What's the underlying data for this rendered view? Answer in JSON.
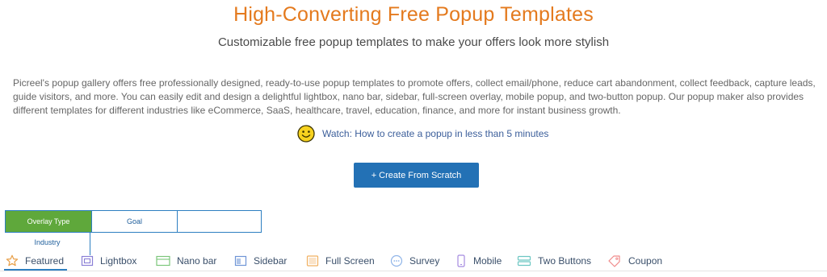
{
  "header": {
    "title": "High-Converting Free Popup Templates",
    "subtitle": "Customizable free popup templates to make your offers look more stylish"
  },
  "description": "Picreel's popup gallery offers free professionally designed, ready-to-use popup templates to promote offers, collect email/phone, reduce cart abandonment, collect feedback, capture leads, guide visitors, and more. You can easily edit and design a delightful lightbox, nano bar, sidebar, full-screen overlay, mobile popup, and two-button popup. Our popup maker also provides different templates for different industries like eCommerce, SaaS, healthcare, travel, education, finance, and more for instant business growth.",
  "watch": {
    "label": "Watch: How to create a popup in less than 5 minutes",
    "icon": "smiley-icon"
  },
  "create_button": {
    "label": "+ Create From Scratch"
  },
  "filter": {
    "selected": "Overlay Type",
    "options": [
      "Overlay Type",
      "Goal",
      "",
      "Industry"
    ]
  },
  "tabs": [
    {
      "label": "Featured",
      "icon": "star-icon",
      "active": true,
      "color": "#e8a04a"
    },
    {
      "label": "Lightbox",
      "icon": "lightbox-icon",
      "active": false,
      "color": "#8a7fd6"
    },
    {
      "label": "Nano bar",
      "icon": "nano-bar-icon",
      "active": false,
      "color": "#7cc67a"
    },
    {
      "label": "Sidebar",
      "icon": "sidebar-icon",
      "active": false,
      "color": "#6f95d6"
    },
    {
      "label": "Full Screen",
      "icon": "full-screen-icon",
      "active": false,
      "color": "#f0b060"
    },
    {
      "label": "Survey",
      "icon": "survey-icon",
      "active": false,
      "color": "#8fb4e8"
    },
    {
      "label": "Mobile",
      "icon": "mobile-icon",
      "active": false,
      "color": "#a58ae0"
    },
    {
      "label": "Two Buttons",
      "icon": "two-buttons-icon",
      "active": false,
      "color": "#6cc6c2"
    },
    {
      "label": "Coupon",
      "icon": "coupon-icon",
      "active": false,
      "color": "#f08a8a"
    }
  ],
  "colors": {
    "title": "#e47a1e",
    "accent_blue": "#2371b5",
    "selected_green": "#5fa83b",
    "link": "#3b5e9a"
  }
}
